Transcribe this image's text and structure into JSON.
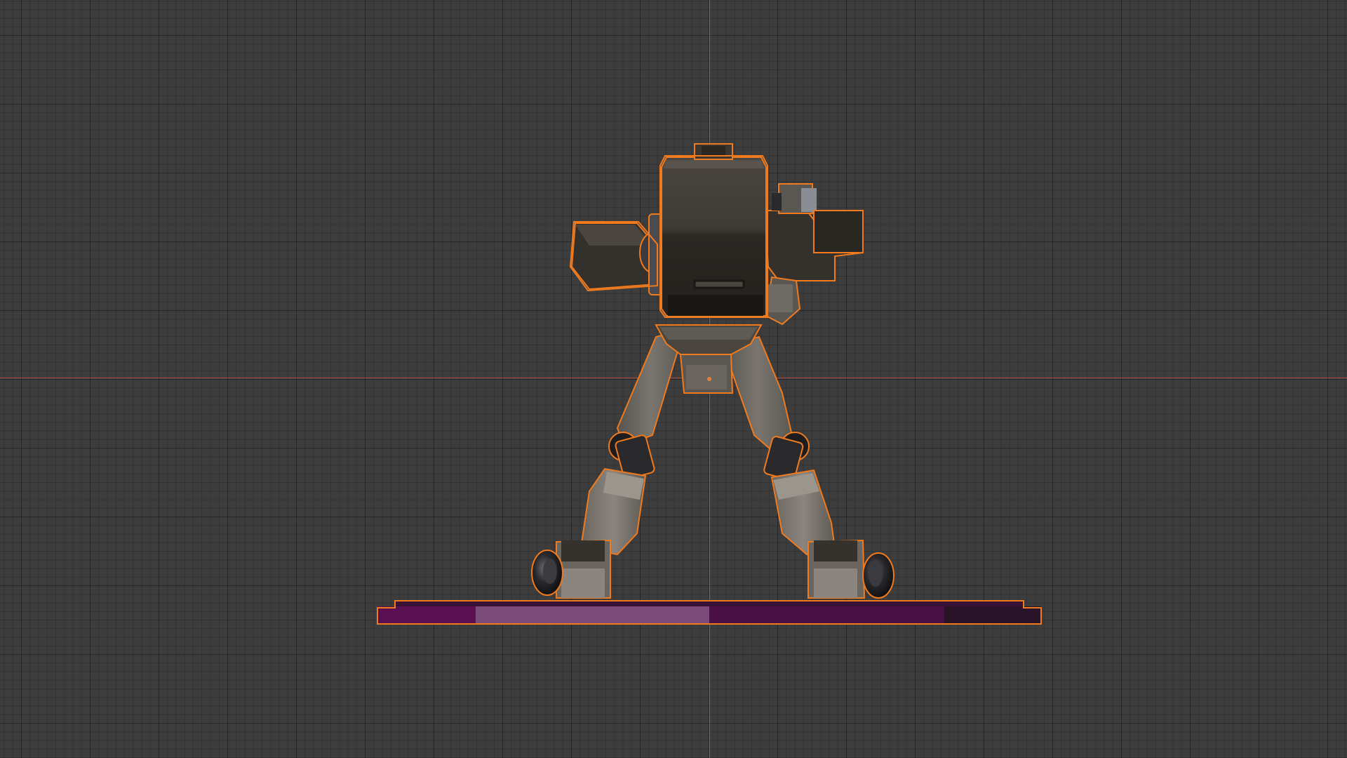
{
  "viewport": {
    "view": "front-orthographic",
    "background_color": "#3d3d3d",
    "grid_color": "#2a2a2a"
  },
  "axes": {
    "x_axis_color": "#b34a4a",
    "z_axis_color": "#4a7ab3"
  },
  "selection": {
    "outline_color": "#f07a1e"
  },
  "object": {
    "name": "robot-mech",
    "body_color": "#6e6a64",
    "dark_color": "#2e2a25",
    "joint_color": "#1d1d1f"
  },
  "pedestal": {
    "colors": [
      "#5a1050",
      "#7a4a78",
      "#4a0f45",
      "#2a1228"
    ]
  }
}
